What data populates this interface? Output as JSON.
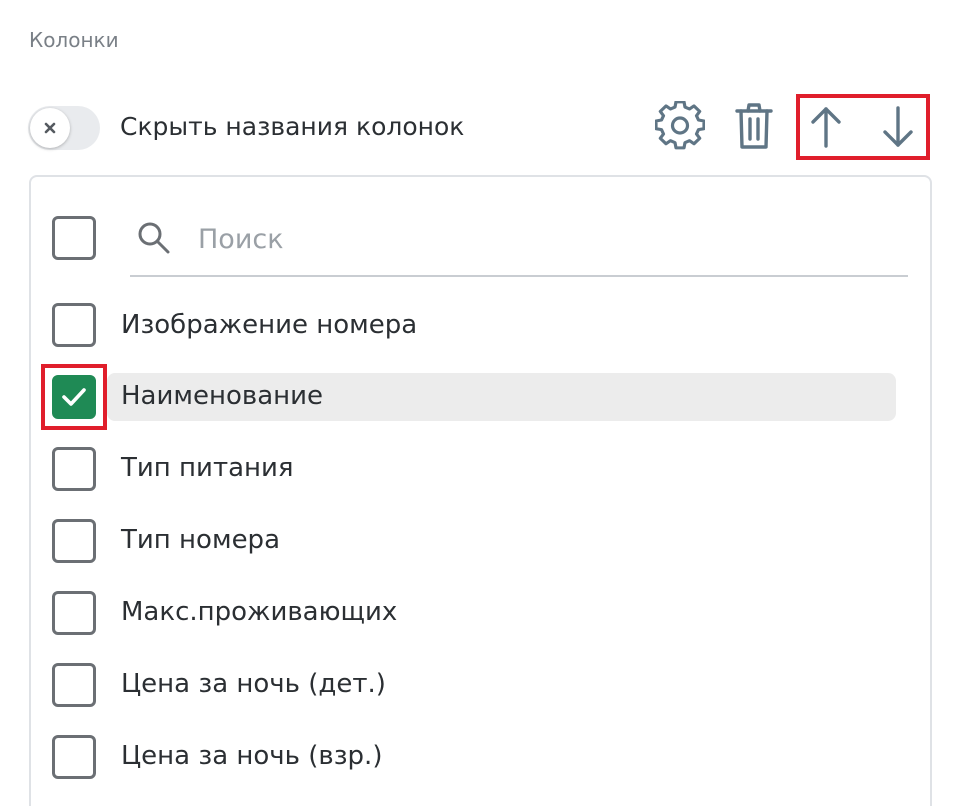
{
  "section": {
    "title": "Колонки"
  },
  "toggle": {
    "label": "Скрыть названия колонок",
    "state": "off"
  },
  "toolbar": {
    "settings_icon": "gear-icon",
    "delete_icon": "trash-icon",
    "up_icon": "arrow-up-icon",
    "down_icon": "arrow-down-icon"
  },
  "search": {
    "placeholder": "Поиск",
    "value": ""
  },
  "columns": {
    "items": [
      {
        "label": "Изображение номера",
        "checked": false
      },
      {
        "label": "Наименование",
        "checked": true
      },
      {
        "label": "Тип питания",
        "checked": false
      },
      {
        "label": "Тип номера",
        "checked": false
      },
      {
        "label": "Макс.проживающих",
        "checked": false
      },
      {
        "label": "Цена за ночь (дет.)",
        "checked": false
      },
      {
        "label": "Цена за ночь (взр.)",
        "checked": false
      }
    ]
  },
  "colors": {
    "accent": "#1f8a55",
    "highlight": "#e01e2b",
    "icon": "#5f7585"
  }
}
